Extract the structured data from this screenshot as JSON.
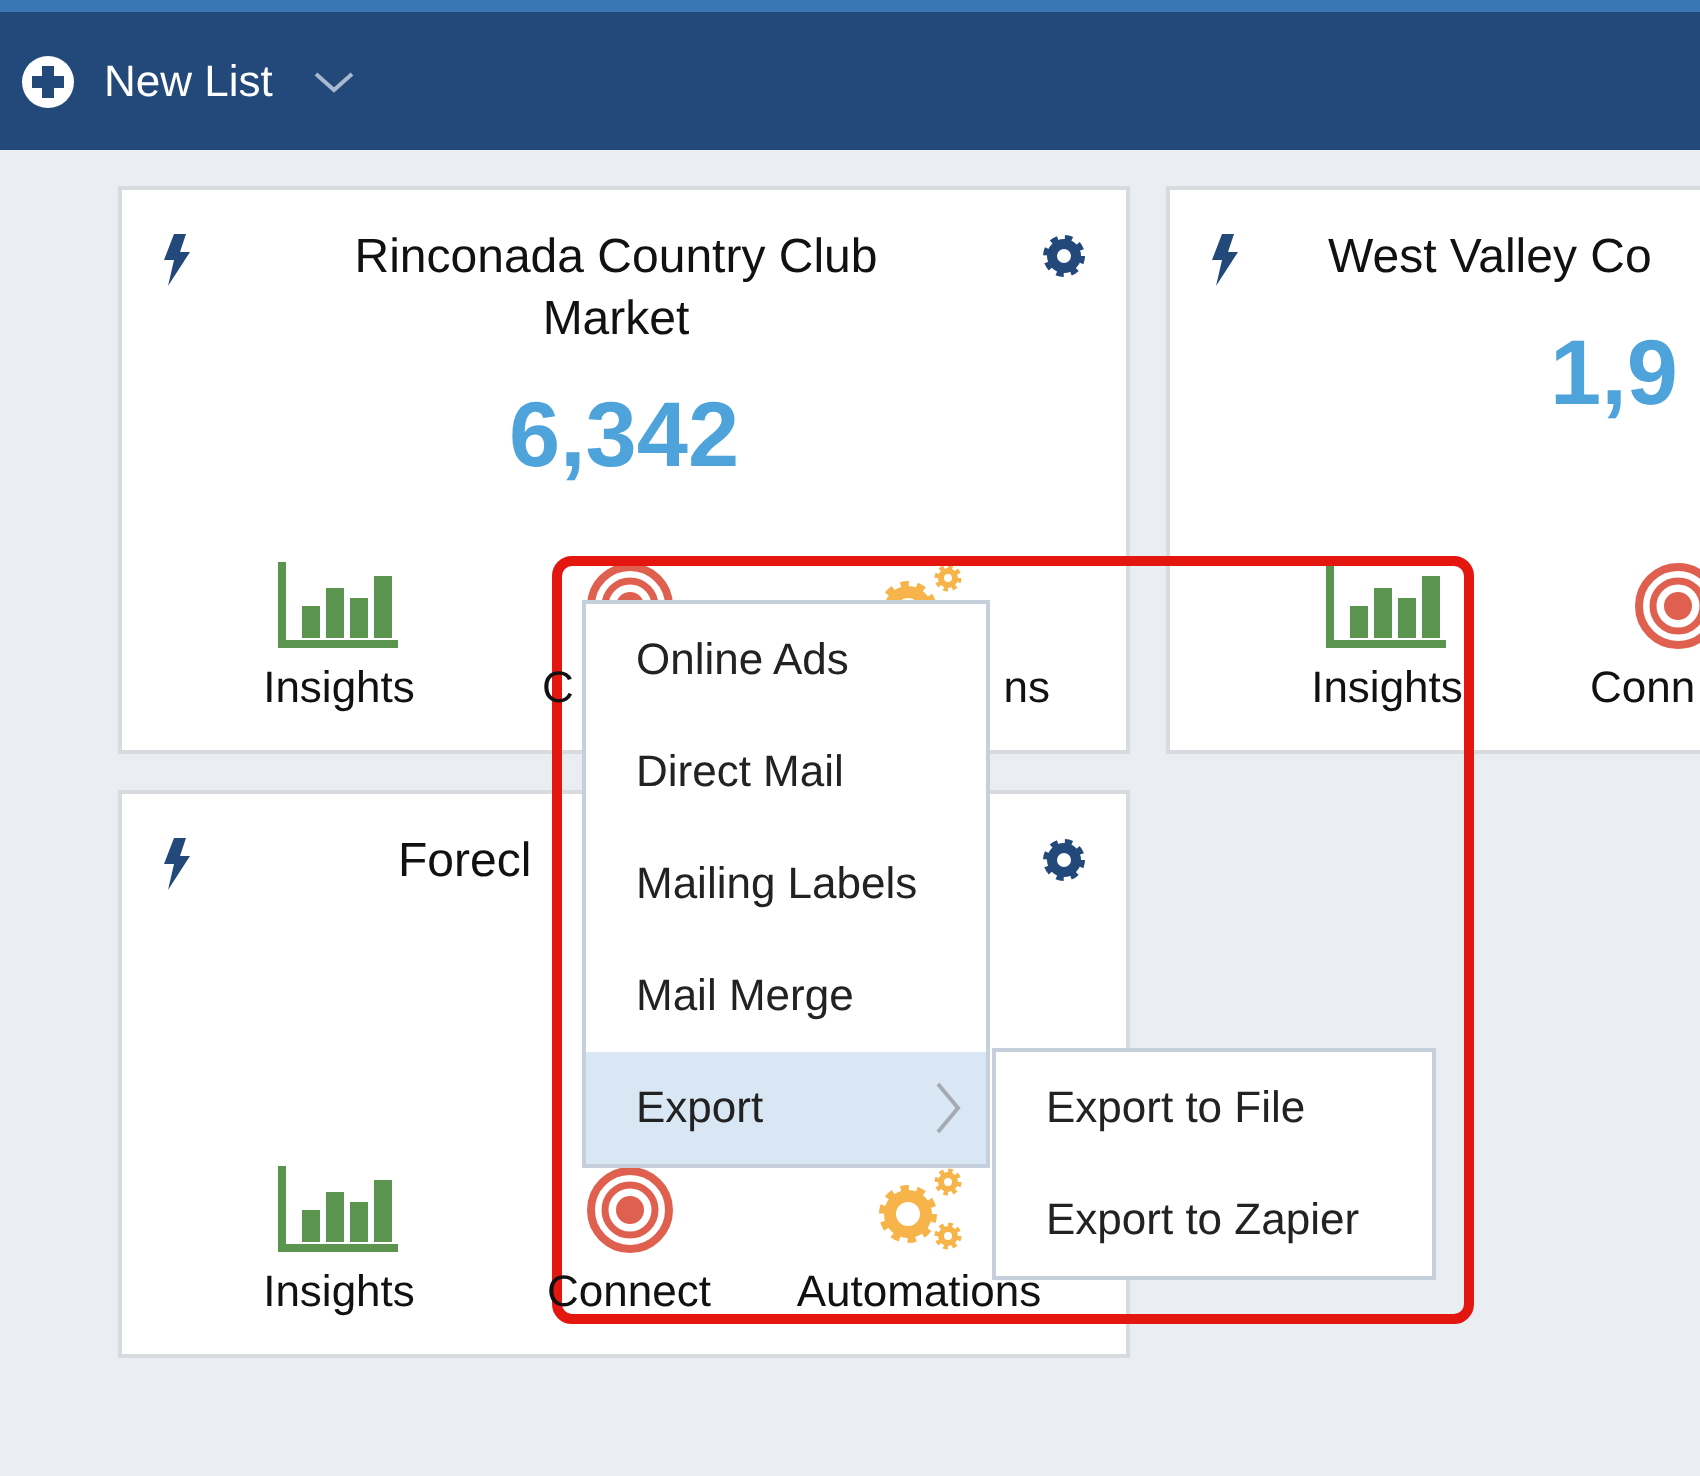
{
  "header": {
    "button_label": "New List"
  },
  "cards": [
    {
      "title": "Rinconada Country Club Market",
      "count": "6,342",
      "actions": [
        {
          "kind": "insights",
          "label": "Insights"
        },
        {
          "kind": "connect",
          "label": "C"
        },
        {
          "kind": "automations",
          "label": "ns"
        }
      ]
    },
    {
      "title": "West Valley Co",
      "count": "1,9",
      "actions": [
        {
          "kind": "insights",
          "label": "Insights"
        },
        {
          "kind": "connect",
          "label": "Conn"
        }
      ]
    },
    {
      "title": "Forecl",
      "actions": [
        {
          "kind": "insights",
          "label": "Insights"
        },
        {
          "kind": "connect",
          "label": "Connect"
        },
        {
          "kind": "automations",
          "label": "Automations"
        }
      ]
    }
  ],
  "context_menu": {
    "items": [
      {
        "label": "Online Ads",
        "selected": false,
        "has_submenu": false
      },
      {
        "label": "Direct Mail",
        "selected": false,
        "has_submenu": false
      },
      {
        "label": "Mailing Labels",
        "selected": false,
        "has_submenu": false
      },
      {
        "label": "Mail Merge",
        "selected": false,
        "has_submenu": false
      },
      {
        "label": "Export",
        "selected": true,
        "has_submenu": true
      }
    ],
    "submenu": {
      "items": [
        {
          "label": "Export to File"
        },
        {
          "label": "Export to Zapier"
        }
      ]
    }
  }
}
